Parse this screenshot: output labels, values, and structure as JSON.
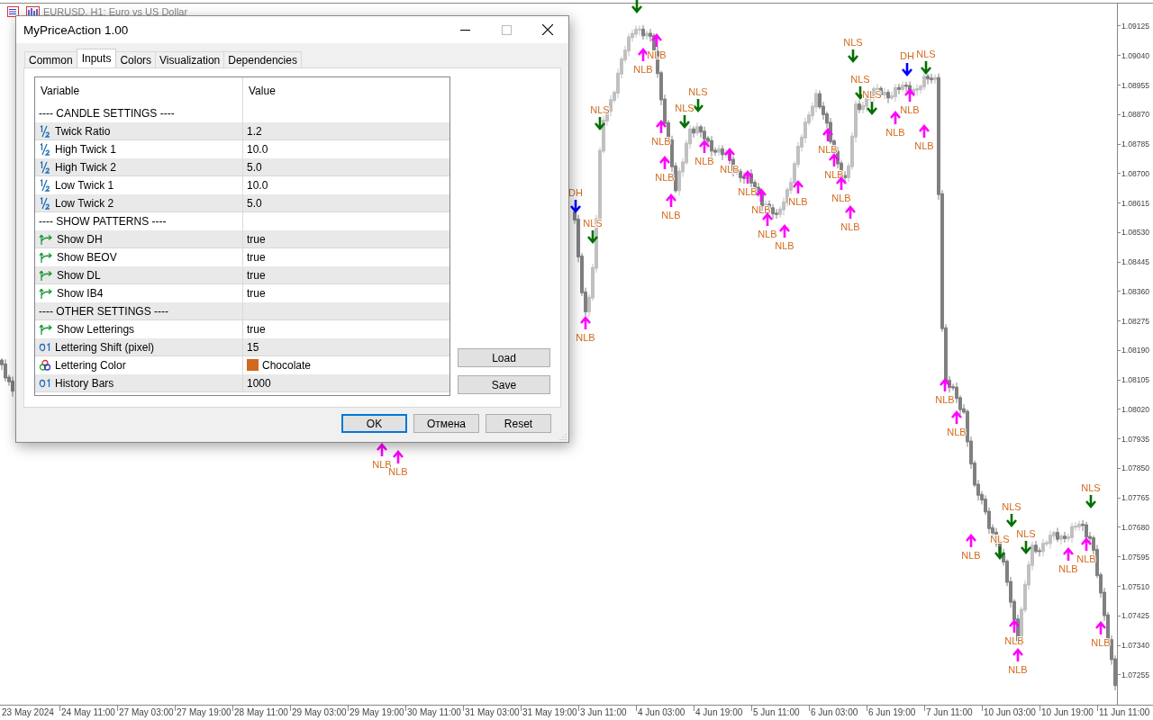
{
  "chart": {
    "title": "EURUSD, H1:  Euro vs US Dollar",
    "signals": [
      {
        "kind": "dh",
        "label": "DH"
      },
      {
        "kind": "sell",
        "label": "NLS"
      },
      {
        "kind": "buy",
        "label": "NLB"
      },
      {
        "kind": "sell",
        "label": "NLS"
      },
      {
        "kind": "sell"
      },
      {
        "kind": "buy",
        "label": "NLB"
      },
      {
        "kind": "buy",
        "label": "NLB"
      },
      {
        "kind": "buy",
        "label": "NLB"
      },
      {
        "kind": "buy",
        "label": "NLB"
      },
      {
        "kind": "buy",
        "label": "NLB"
      },
      {
        "kind": "sell",
        "label": "NLS"
      },
      {
        "kind": "sell",
        "label": "NLS"
      },
      {
        "kind": "buy",
        "label": "NLB"
      },
      {
        "kind": "buy",
        "label": "NLB"
      },
      {
        "kind": "buy",
        "label": "NLB"
      },
      {
        "kind": "buy",
        "label": "NLB"
      },
      {
        "kind": "buy",
        "label": "NLB"
      },
      {
        "kind": "buy",
        "label": "NLB"
      },
      {
        "kind": "buy",
        "label": "NLB"
      },
      {
        "kind": "buy",
        "label": "NLB"
      },
      {
        "kind": "buy",
        "label": "NLB"
      },
      {
        "kind": "buy",
        "label": "NLB"
      },
      {
        "kind": "buy",
        "label": "NLB"
      },
      {
        "kind": "sell",
        "label": "NLS"
      },
      {
        "kind": "sell",
        "label": "NLS"
      },
      {
        "kind": "sell",
        "label": "NLS"
      },
      {
        "kind": "dh",
        "label": "DH"
      },
      {
        "kind": "sell",
        "label": "NLS"
      },
      {
        "kind": "buy",
        "label": "NLB"
      },
      {
        "kind": "buy",
        "label": "NLB"
      },
      {
        "kind": "buy",
        "label": "NLB"
      },
      {
        "kind": "buy",
        "label": "NLB"
      },
      {
        "kind": "buy",
        "label": "NLB"
      },
      {
        "kind": "buy",
        "label": "NLB"
      },
      {
        "kind": "sell",
        "label": "NLS"
      },
      {
        "kind": "sell",
        "label": "NLS"
      },
      {
        "kind": "sell",
        "label": "NLS"
      },
      {
        "kind": "buy",
        "label": "NLB"
      },
      {
        "kind": "buy",
        "label": "NLB"
      },
      {
        "kind": "buy",
        "label": "NLB"
      },
      {
        "kind": "buy",
        "label": "NLB"
      },
      {
        "kind": "sell",
        "label": "NLS"
      },
      {
        "kind": "buy",
        "label": "NLB"
      },
      {
        "kind": "buy",
        "label": "NLB"
      },
      {
        "kind": "buy",
        "label": "NLB"
      }
    ],
    "price_axis": [
      "1.09125",
      "1.09040",
      "1.08955",
      "1.08870",
      "1.08785",
      "1.08700",
      "1.08615",
      "1.08530",
      "1.08445",
      "1.08360",
      "1.08275",
      "1.08190",
      "1.08105",
      "1.08020",
      "1.07935",
      "1.07850",
      "1.07765",
      "1.07680",
      "1.07595",
      "1.07510",
      "1.07425",
      "1.07340",
      "1.07255"
    ],
    "time_axis": [
      "23 May 2024",
      "24 May 11:00",
      "27 May 03:00",
      "27 May 19:00",
      "28 May 11:00",
      "29 May 03:00",
      "29 May 19:00",
      "30 May 11:00",
      "31 May 03:00",
      "31 May 19:00",
      "3 Jun 11:00",
      "4 Jun 03:00",
      "4 Jun 19:00",
      "5 Jun 11:00",
      "6 Jun 03:00",
      "6 Jun 19:00",
      "7 Jun 11:00",
      "10 Jun 03:00",
      "10 Jun 19:00",
      "11 Jun 11:00"
    ]
  },
  "dialog": {
    "title": "MyPriceAction 1.00",
    "tabs": [
      {
        "label": "Common",
        "selected": false
      },
      {
        "label": "Inputs",
        "selected": true
      },
      {
        "label": "Colors",
        "selected": false
      },
      {
        "label": "Visualization",
        "selected": false
      },
      {
        "label": "Dependencies",
        "selected": false
      }
    ],
    "table": {
      "columns": [
        "Variable",
        "Value"
      ],
      "rows": [
        {
          "kind": "section",
          "variable": "---- CANDLE SETTINGS ----"
        },
        {
          "kind": "fraction",
          "variable": "Twick Ratio",
          "value": "1.2"
        },
        {
          "kind": "fraction",
          "variable": "High Twick 1",
          "value": "10.0"
        },
        {
          "kind": "fraction",
          "variable": "High Twick 2",
          "value": "5.0"
        },
        {
          "kind": "fraction",
          "variable": "Low Twick 1",
          "value": "10.0"
        },
        {
          "kind": "fraction",
          "variable": "Low Twick 2",
          "value": "5.0"
        },
        {
          "kind": "section",
          "variable": "---- SHOW PATTERNS ----"
        },
        {
          "kind": "bool",
          "variable": "Show DH",
          "value": "true"
        },
        {
          "kind": "bool",
          "variable": "Show BEOV",
          "value": "true"
        },
        {
          "kind": "bool",
          "variable": "Show DL",
          "value": "true"
        },
        {
          "kind": "bool",
          "variable": "Show IB4",
          "value": "true"
        },
        {
          "kind": "section",
          "variable": "---- OTHER SETTINGS ----"
        },
        {
          "kind": "bool",
          "variable": "Show Letterings",
          "value": "true"
        },
        {
          "kind": "int",
          "variable": "Lettering Shift (pixel)",
          "value": "15"
        },
        {
          "kind": "color",
          "variable": "Lettering Color",
          "value": "Chocolate",
          "color": "#d2691e"
        },
        {
          "kind": "int",
          "variable": "History Bars",
          "value": "1000"
        }
      ]
    },
    "side_buttons": [
      "Load",
      "Save"
    ],
    "buttons": [
      {
        "label": "OK",
        "default": true
      },
      {
        "label": "Отмена",
        "default": false
      },
      {
        "label": "Reset",
        "default": false
      }
    ]
  }
}
